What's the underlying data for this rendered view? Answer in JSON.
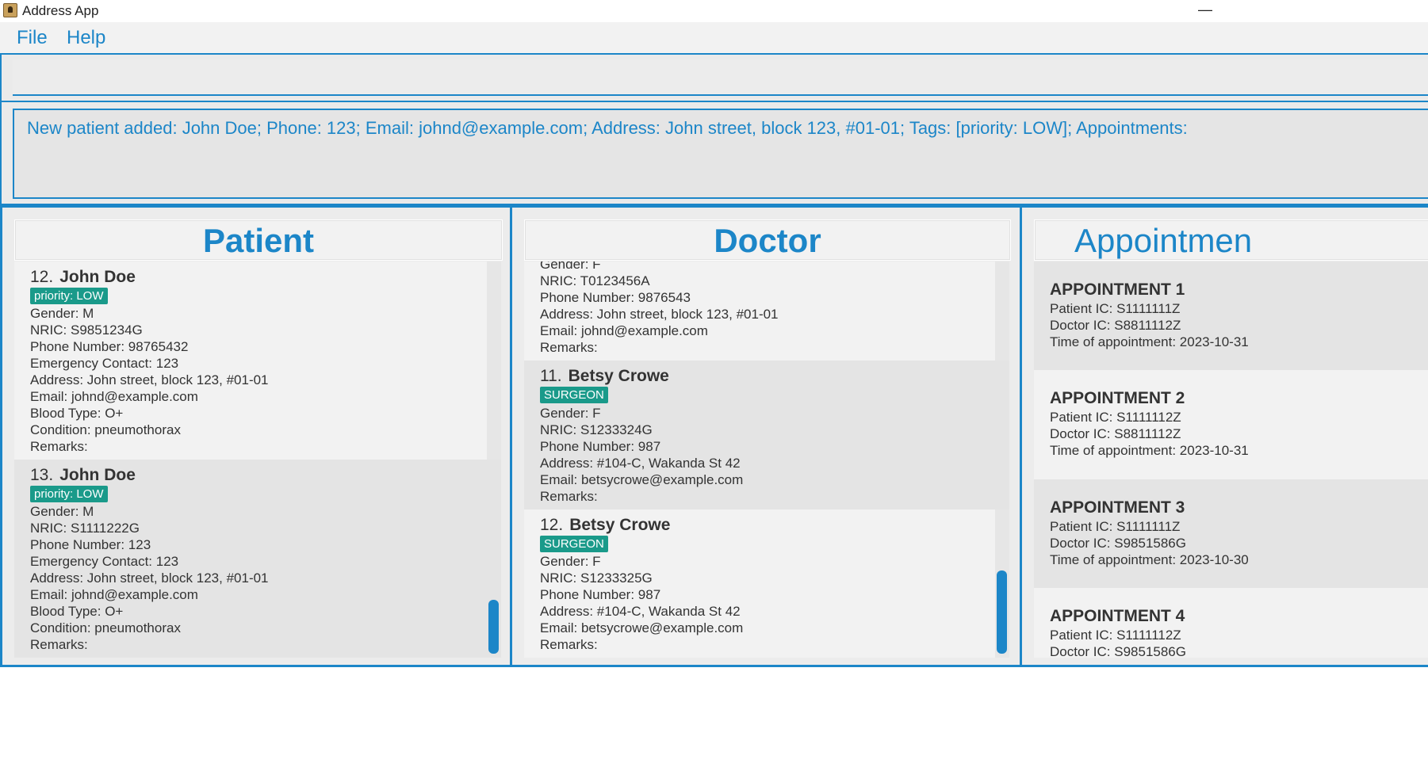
{
  "window": {
    "title": "Address App",
    "minimize": "—"
  },
  "menu": {
    "file": "File",
    "help": "Help"
  },
  "command": {
    "value": "",
    "placeholder": ""
  },
  "result": {
    "text": "New patient added: John Doe; Phone: 123; Email: johnd@example.com; Address: John street, block 123, #01-01; Tags: [priority: LOW]; Appointments:"
  },
  "patient_panel": {
    "title": "Patient",
    "cards": [
      {
        "index": "12.",
        "name": "John Doe",
        "tag": "priority: LOW",
        "lines": [
          "Gender: M",
          "NRIC: S9851234G",
          "Phone Number: 98765432",
          "Emergency Contact: 123",
          "Address: John street, block 123, #01-01",
          "Email: johnd@example.com",
          "Blood Type: O+",
          "Condition: pneumothorax",
          "Remarks:"
        ]
      },
      {
        "index": "13.",
        "name": "John Doe",
        "tag": "priority: LOW",
        "lines": [
          "Gender: M",
          "NRIC: S1111222G",
          "Phone Number: 123",
          "Emergency Contact: 123",
          "Address: John street, block 123, #01-01",
          "Email: johnd@example.com",
          "Blood Type: O+",
          "Condition: pneumothorax",
          "Remarks:"
        ]
      }
    ]
  },
  "doctor_panel": {
    "title": "Doctor",
    "partial_card": {
      "lines": [
        "Gender: F",
        "NRIC: T0123456A",
        "Phone Number: 9876543",
        "Address: John street, block 123, #01-01",
        "Email: johnd@example.com",
        "Remarks:"
      ]
    },
    "cards": [
      {
        "index": "11.",
        "name": "Betsy Crowe",
        "tag": "SURGEON",
        "lines": [
          "Gender: F",
          "NRIC: S1233324G",
          "Phone Number: 987",
          "Address: #104-C, Wakanda St 42",
          "Email: betsycrowe@example.com",
          "Remarks:"
        ]
      },
      {
        "index": "12.",
        "name": "Betsy Crowe",
        "tag": "SURGEON",
        "lines": [
          "Gender: F",
          "NRIC: S1233325G",
          "Phone Number: 987",
          "Address: #104-C, Wakanda St 42",
          "Email: betsycrowe@example.com",
          "Remarks:"
        ]
      }
    ]
  },
  "appointment_panel": {
    "title": "Appointmen",
    "cards": [
      {
        "title": "APPOINTMENT 1",
        "lines": [
          "Patient IC: S1111111Z",
          "Doctor IC: S8811112Z",
          "Time of appointment: 2023-10-31"
        ]
      },
      {
        "title": "APPOINTMENT 2",
        "lines": [
          "Patient IC: S1111112Z",
          "Doctor IC: S8811112Z",
          "Time of appointment: 2023-10-31"
        ]
      },
      {
        "title": "APPOINTMENT 3",
        "lines": [
          "Patient IC: S1111111Z",
          "Doctor IC: S9851586G",
          "Time of appointment: 2023-10-30"
        ]
      },
      {
        "title": "APPOINTMENT 4",
        "lines": [
          "Patient IC: S1111112Z",
          "Doctor IC: S9851586G"
        ]
      }
    ]
  },
  "colors": {
    "accent": "#1c86c8",
    "tag": "#1a9a8a"
  }
}
